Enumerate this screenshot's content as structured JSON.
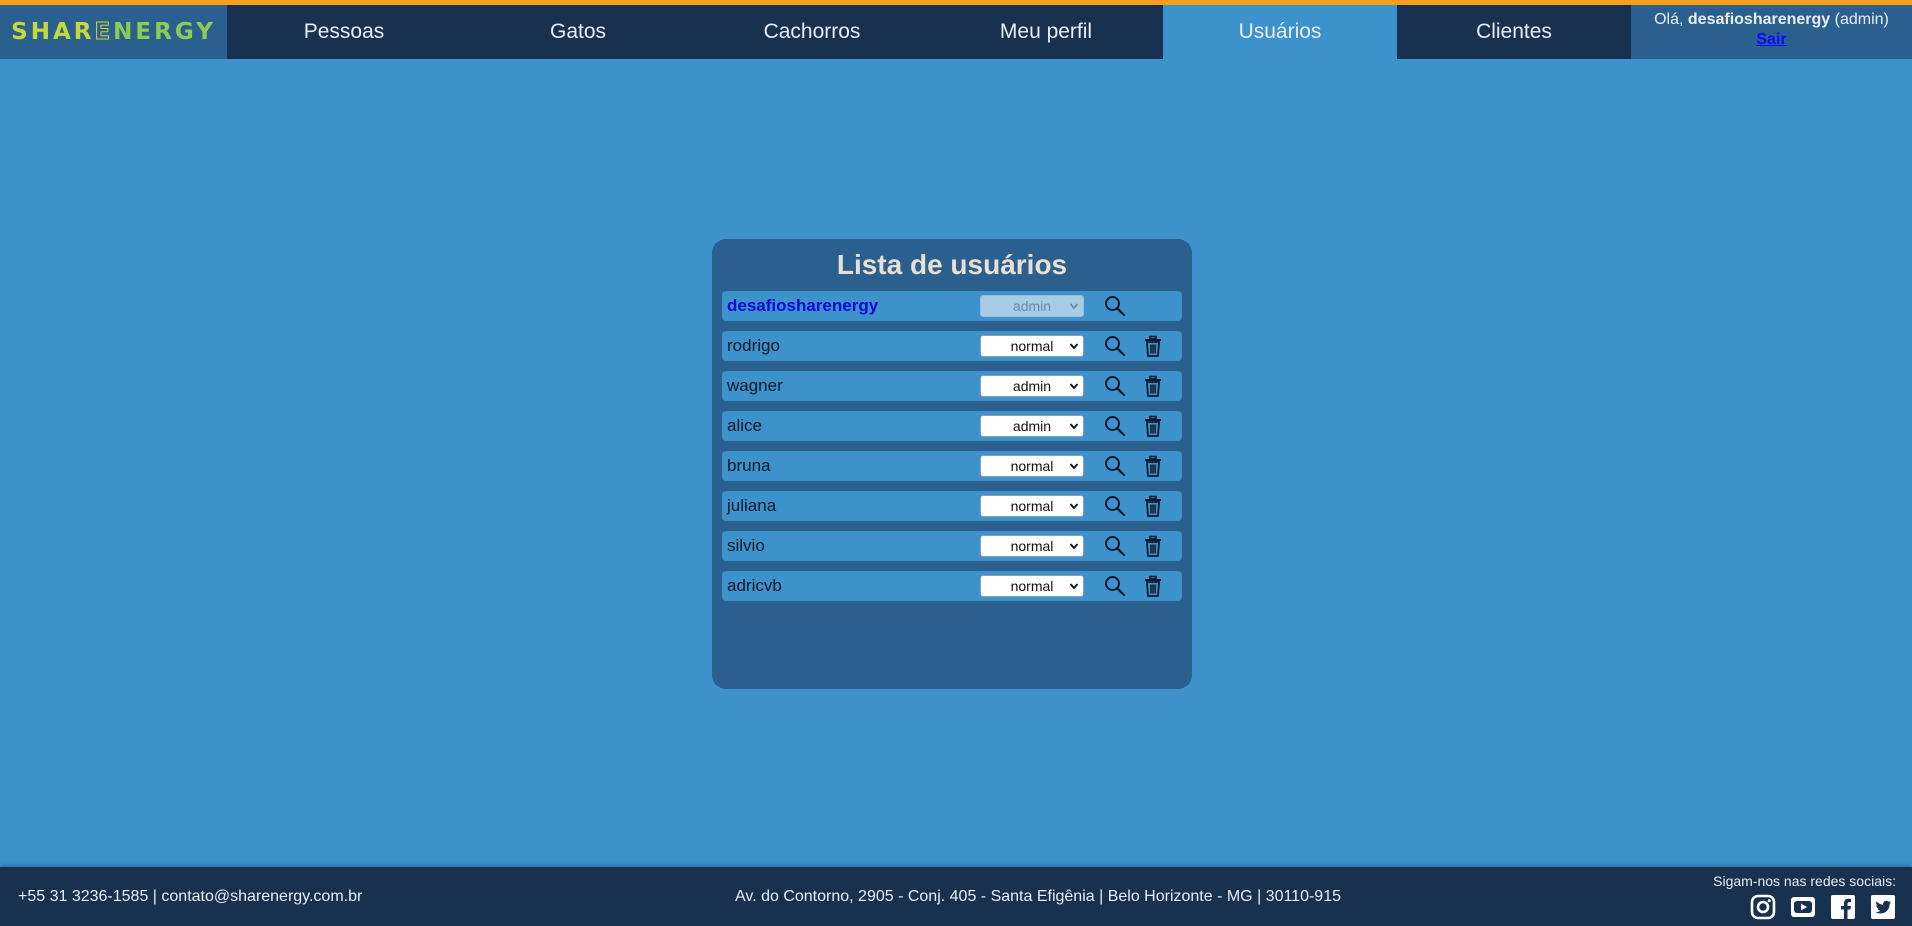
{
  "colors": {
    "accent_bar": "#f5a01b",
    "nav_bg": "#17314f",
    "page_bg": "#3d92cc",
    "panel_bg": "#2b5f8e",
    "self_user": "#0a0ad6",
    "logout_link": "#0a0aff"
  },
  "logo": {
    "text_part1": "SHAR",
    "text_mark": "E",
    "text_part2": "NERGY"
  },
  "nav": {
    "tabs": [
      {
        "label": "Pessoas"
      },
      {
        "label": "Gatos"
      },
      {
        "label": "Cachorros"
      },
      {
        "label": "Meu perfil"
      },
      {
        "label": "Usuários",
        "active": true
      },
      {
        "label": "Clientes"
      }
    ]
  },
  "user_box": {
    "greeting": "Olá, ",
    "username": "desafiosharenergy",
    "role": " (admin)",
    "logout_label": "Sair"
  },
  "panel": {
    "title": "Lista de usuários",
    "users": [
      {
        "name": "desafiosharenergy",
        "role": "admin",
        "self": true
      },
      {
        "name": "rodrigo",
        "role": "normal"
      },
      {
        "name": "wagner",
        "role": "admin"
      },
      {
        "name": "alice",
        "role": "admin"
      },
      {
        "name": "bruna",
        "role": "normal"
      },
      {
        "name": "juliana",
        "role": "normal"
      },
      {
        "name": "silvio",
        "role": "normal"
      },
      {
        "name": "adricvb",
        "role": "normal"
      }
    ],
    "icons": {
      "search": "search-icon",
      "delete": "trash-icon"
    }
  },
  "footer": {
    "contact": "+55 31 3236-1585 | contato@sharenergy.com.br",
    "address": "Av. do Contorno, 2905 - Conj. 405 - Santa Efigênia | Belo Horizonte - MG | 30110-915",
    "social_label": "Sigam-nos nas redes sociais:",
    "social_icons": [
      "instagram-icon",
      "youtube-icon",
      "facebook-icon",
      "twitter-icon"
    ]
  }
}
